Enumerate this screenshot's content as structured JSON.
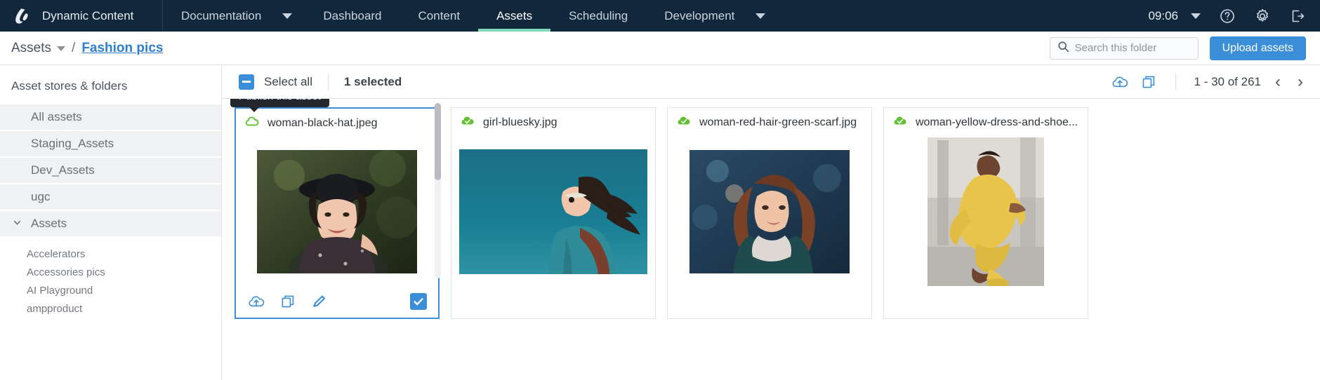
{
  "topnav": {
    "brand": "Dynamic Content",
    "items": [
      {
        "label": "Documentation",
        "caret": true,
        "active": false
      },
      {
        "label": "Dashboard",
        "caret": false,
        "active": false
      },
      {
        "label": "Content",
        "caret": false,
        "active": false
      },
      {
        "label": "Assets",
        "caret": false,
        "active": true
      },
      {
        "label": "Scheduling",
        "caret": false,
        "active": false
      },
      {
        "label": "Development",
        "caret": true,
        "active": false
      }
    ],
    "time": "09:06",
    "icons": [
      "chevron-down-icon",
      "help-icon",
      "gear-icon",
      "logout-icon"
    ],
    "accent": "#7fd6bb",
    "background": "#11273b"
  },
  "breadcrumb": {
    "root": "Assets",
    "separator": "/",
    "current": "Fashion pics",
    "link_color": "#2f7fd0"
  },
  "search": {
    "placeholder": "Search this folder",
    "value": ""
  },
  "upload_button": {
    "label": "Upload assets",
    "color": "#3b8fd9"
  },
  "sidebar": {
    "title": "Asset stores & folders",
    "stores": [
      {
        "label": "All assets",
        "expandable": false
      },
      {
        "label": "Staging_Assets",
        "expandable": false
      },
      {
        "label": "Dev_Assets",
        "expandable": false
      },
      {
        "label": "ugc",
        "expandable": false
      },
      {
        "label": "Assets",
        "expandable": true,
        "expanded": true
      }
    ],
    "folders": [
      {
        "label": "Accelerators"
      },
      {
        "label": "Accessories pics"
      },
      {
        "label": "AI Playground"
      },
      {
        "label": "ampproduct"
      }
    ]
  },
  "toolbar": {
    "select_all_label": "Select all",
    "selected_count_label": "1 selected",
    "actions": [
      "publish-icon",
      "copy-icon"
    ],
    "pagination_label": "1 - 30 of 261",
    "prev_label": "‹",
    "next_label": "›"
  },
  "assets": [
    {
      "filename": "woman-black-hat.jpeg",
      "status": "unpublished",
      "selected": true,
      "tooltip": "Publish this asset",
      "actions": [
        "publish-icon",
        "copy-icon",
        "edit-icon"
      ],
      "thumb_orientation": "portrait"
    },
    {
      "filename": "girl-bluesky.jpg",
      "status": "published",
      "selected": false,
      "thumb_orientation": "landscape"
    },
    {
      "filename": "woman-red-hair-green-scarf.jpg",
      "status": "published",
      "selected": false,
      "thumb_orientation": "portrait"
    },
    {
      "filename": "woman-yellow-dress-and-shoe...",
      "status": "published",
      "selected": false,
      "thumb_orientation": "portrait"
    }
  ]
}
